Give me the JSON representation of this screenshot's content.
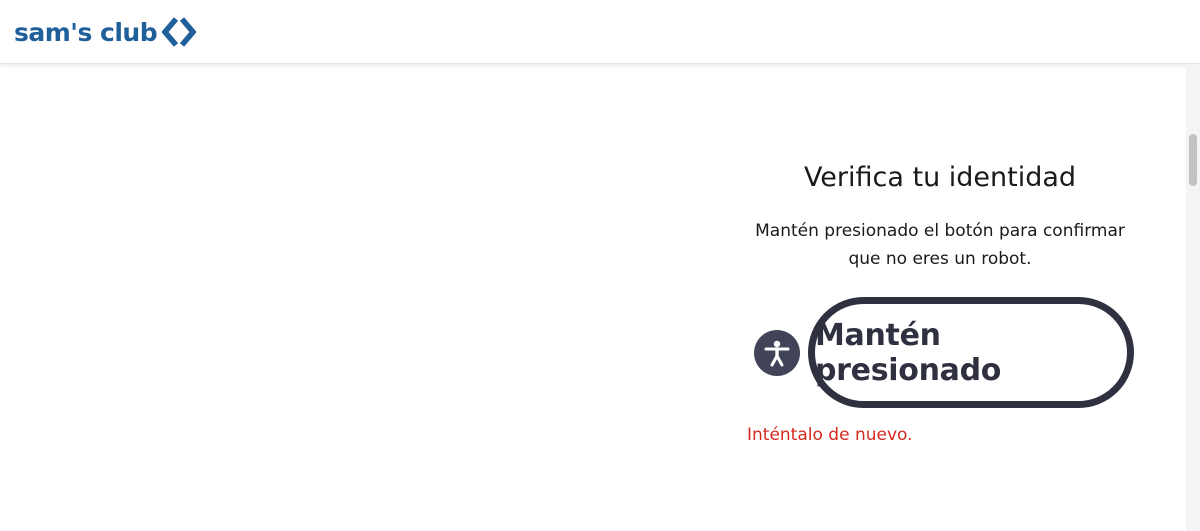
{
  "header": {
    "logo_text": "sam's club",
    "logo_icon": "sams-club-diamond-logo"
  },
  "verification": {
    "title": "Verifica tu identidad",
    "instructions_line1": "Mantén presionado el botón para confirmar",
    "instructions_line2": "que no eres un robot.",
    "hold_button_label": "Mantén presionado",
    "accessibility_icon": "accessibility-person-icon",
    "error_message": "Inténtalo de nuevo."
  },
  "colors": {
    "brand_blue": "#1f5f9a",
    "text": "#1a1a1a",
    "button_border": "#2f3140",
    "accessibility_bg": "#414458",
    "error": "#d42a1f"
  }
}
